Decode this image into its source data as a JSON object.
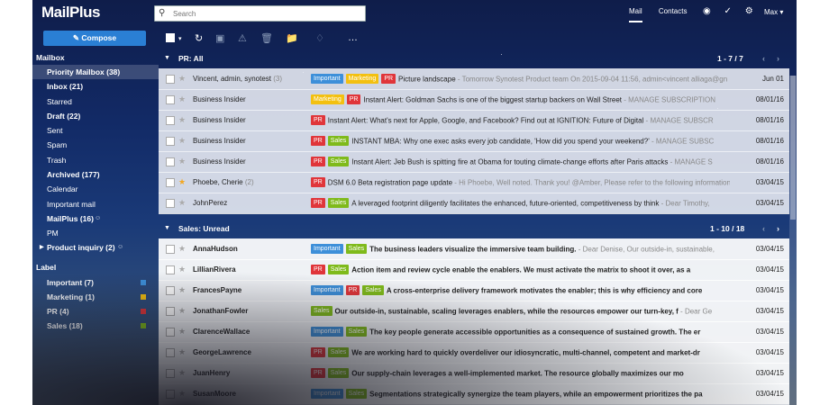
{
  "app": {
    "name": "MailPlus"
  },
  "search": {
    "placeholder": "Search"
  },
  "nav": {
    "mail": "Mail",
    "contacts": "Contacts",
    "user": "Max"
  },
  "compose": {
    "label": "Compose"
  },
  "sidebar": {
    "mailbox_title": "Mailbox",
    "label_title": "Label",
    "mailbox_items": [
      {
        "label": "Priority Mailbox (38)"
      },
      {
        "label": "Inbox (21)"
      },
      {
        "label": "Starred"
      },
      {
        "label": "Draft (22)"
      },
      {
        "label": "Sent"
      },
      {
        "label": "Spam"
      },
      {
        "label": "Trash"
      },
      {
        "label": "Archived (177)"
      },
      {
        "label": "Calendar"
      },
      {
        "label": "Important mail"
      },
      {
        "label": "MailPlus (16)"
      },
      {
        "label": "PM"
      },
      {
        "label": "Product inquiry (2)"
      }
    ],
    "labels": [
      {
        "label": "Important (7)",
        "color": "#3d8fd9"
      },
      {
        "label": "Marketing (1)",
        "color": "#f3c010"
      },
      {
        "label": "PR (4)",
        "color": "#e0353a"
      },
      {
        "label": "Sales (18)",
        "color": "#7fba1b"
      }
    ]
  },
  "groups": {
    "pr": {
      "name": "PR: All",
      "range": "1 - 7 / 7"
    },
    "sales": {
      "name": "Sales: Unread",
      "range": "1 - 10 / 18"
    }
  },
  "tag_names": {
    "important": "Important",
    "marketing": "Marketing",
    "pr": "PR",
    "sales": "Sales"
  },
  "pr_rows": [
    {
      "sender": "Vincent, admin, synotest",
      "count": "(3)",
      "subject": "Picture landscape",
      "snippet": " - Tomorrow Synotest Product team On 2015-09-04 11:56, admin<vincent alliaga@gn",
      "date": "Jun 01"
    },
    {
      "sender": "Business Insider",
      "count": "",
      "subject": "Instant Alert: Goldman Sachs is one of the biggest startup backers on Wall Street",
      "snippet": " - MANAGE SUBSCRIPTION",
      "date": "08/01/16"
    },
    {
      "sender": "Business Insider",
      "count": "",
      "subject": "Instant Alert: What's next for Apple, Google, and Facebook? Find out at IGNITION: Future of Digital",
      "snippet": " - MANAGE SUBSCR",
      "date": "08/01/16"
    },
    {
      "sender": "Business Insider",
      "count": "",
      "subject": "INSTANT MBA: Why one exec asks every job candidate, 'How did you spend your weekend?'",
      "snippet": " - MANAGE SUBSC",
      "date": "08/01/16"
    },
    {
      "sender": "Business Insider",
      "count": "",
      "subject": "Instant Alert: Jeb Bush is spitting fire at Obama for touting climate-change efforts after Paris attacks",
      "snippet": " - MANAGE S",
      "date": "08/01/16"
    },
    {
      "sender": "Phoebe, Cherie",
      "count": "(2)",
      "subject": "DSM 6.0 Beta registration page update",
      "snippet": " - Hi Phoebe, Well noted. Thank you! @Amber, Please refer to the following information",
      "date": "03/04/15"
    },
    {
      "sender": "JohnPerez",
      "count": "",
      "subject": "A leveraged footprint diligently facilitates the enhanced, future-oriented, competitiveness by think",
      "snippet": " - Dear Timothy,",
      "date": "03/04/15"
    }
  ],
  "sales_rows": [
    {
      "sender": "AnnaHudson",
      "subject": "The business leaders visualize the immersive team building.",
      "snippet": " - Dear Denise, Our outside-in, sustainable,",
      "date": "03/04/15"
    },
    {
      "sender": "LillianRivera",
      "subject": "Action item and review cycle enable the enablers. We must activate the matrix to shoot it over, as a",
      "snippet": "",
      "date": "03/04/15"
    },
    {
      "sender": "FrancesPayne",
      "subject": "A cross-enterprise delivery framework motivates the enabler; this is why efficiency and core",
      "snippet": "",
      "date": "03/04/15"
    },
    {
      "sender": "JonathanFowler",
      "subject": "Our outside-in, sustainable, scaling leverages enablers, while the resources empower our turn-key, f",
      "snippet": " - Dear Ge",
      "date": "03/04/15"
    },
    {
      "sender": "ClarenceWallace",
      "subject": "The key people generate accessible opportunities as a consequence of sustained growth. The er",
      "snippet": "",
      "date": "03/04/15"
    },
    {
      "sender": "GeorgeLawrence",
      "subject": "We are working hard to quickly overdeliver our idiosyncratic, multi-channel, competent and market-dr",
      "snippet": "",
      "date": "03/04/15"
    },
    {
      "sender": "JuanHenry",
      "subject": "Our supply-chain leverages a well-implemented market. The resource globally maximizes our mo",
      "snippet": "",
      "date": "03/04/15"
    },
    {
      "sender": "SusanMoore",
      "subject": "Segmentations strategically synergize the team players, while an empowerment prioritizes the pa",
      "snippet": "",
      "date": "03/04/15"
    }
  ]
}
